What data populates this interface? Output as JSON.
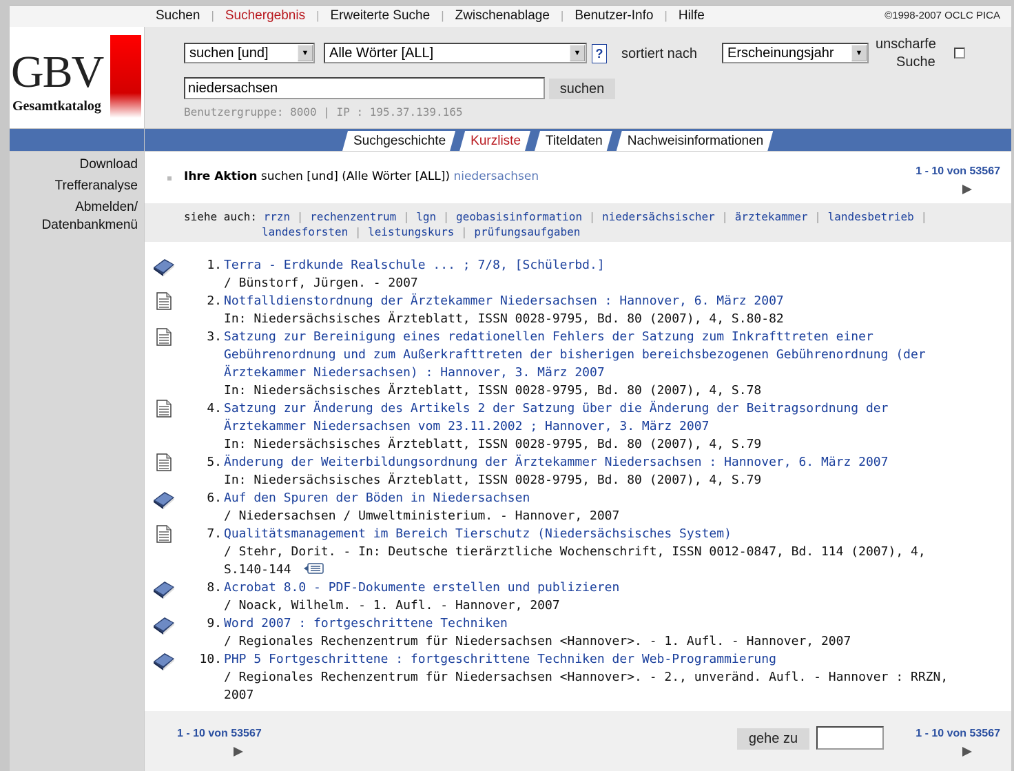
{
  "menu": {
    "items": [
      "Suchen",
      "Suchergebnis",
      "Erweiterte Suche",
      "Zwischenablage",
      "Benutzer-Info",
      "Hilfe"
    ],
    "active": "Suchergebnis",
    "copyright": "©1998-2007 OCLC PICA"
  },
  "logo": {
    "main": "GBV",
    "sub": "Gesamtkatalog"
  },
  "search": {
    "mode": "suchen [und]",
    "field": "Alle Wörter [ALL]",
    "help": "?",
    "sort_label": "sortiert nach",
    "sort_value": "Erscheinungsjahr",
    "fuzzy_label_1": "unscharfe",
    "fuzzy_label_2": "Suche",
    "query": "niedersachsen",
    "button": "suchen",
    "usergroup": "Benutzergruppe: 8000 | IP : 195.37.139.165"
  },
  "tabs": [
    {
      "label": "Suchgeschichte"
    },
    {
      "label": "Kurzliste",
      "active": true
    },
    {
      "label": "Titeldaten"
    },
    {
      "label": "Nachweisinformationen"
    }
  ],
  "sidebar": {
    "download": "Download",
    "analysis": "Trefferanalyse",
    "logout_1": "Abmelden/",
    "logout_2": "Datenbankmenü"
  },
  "action": {
    "prefix": "Ihre Aktion",
    "text": "suchen [und] (Alle Wörter [ALL])",
    "term": "niedersachsen"
  },
  "pager": {
    "range": "1 - 10 von 53567"
  },
  "seealso": {
    "label": "siehe auch:",
    "terms": [
      "rrzn",
      "rechenzentrum",
      "lgn",
      "geobasisinformation",
      "niedersächsischer",
      "ärztekammer",
      "landesbetrieb",
      "landesforsten",
      "leistungskurs",
      "prüfungsaufgaben"
    ]
  },
  "results": [
    {
      "num": "1.",
      "type": "book-icon",
      "title": "Terra - Erdkunde Realschule ... ; 7/8, [Schülerbd.]",
      "detail": "/ Bünstorf, Jürgen. - 2007"
    },
    {
      "num": "2.",
      "type": "article-icon",
      "title": "Notfalldienstordnung der Ärztekammer Niedersachsen : Hannover, 6. März 2007",
      "detail": "In: Niedersächsisches Ärzteblatt, ISSN 0028-9795, Bd. 80 (2007), 4, S.80-82"
    },
    {
      "num": "3.",
      "type": "article-icon",
      "title_lines": [
        "Satzung zur Bereinigung eines redationellen Fehlers der Satzung zum Inkrafttreten einer",
        "Gebührenordnung und zum Außerkrafttreten der bisherigen bereichsbezogenen Gebührenordnung (der",
        "Ärztekammer Niedersachsen) : Hannover, 3. März 2007"
      ],
      "detail": "In: Niedersächsisches Ärzteblatt, ISSN 0028-9795, Bd. 80 (2007), 4, S.78"
    },
    {
      "num": "4.",
      "type": "article-icon",
      "title_lines": [
        "Satzung zur Änderung des Artikels 2 der Satzung über die Änderung der Beitragsordnung der",
        "Ärztekammer Niedersachsen vom 23.11.2002 ; Hannover, 3. März 2007"
      ],
      "detail": "In: Niedersächsisches Ärzteblatt, ISSN 0028-9795, Bd. 80 (2007), 4, S.79"
    },
    {
      "num": "5.",
      "type": "article-icon",
      "title": "Änderung der Weiterbildungsordnung der Ärztekammer Niedersachsen : Hannover, 6. März 2007",
      "detail": "In: Niedersächsisches Ärzteblatt, ISSN 0028-9795, Bd. 80 (2007), 4, S.79"
    },
    {
      "num": "6.",
      "type": "book-icon",
      "title": "Auf den Spuren der Böden in Niedersachsen",
      "detail": "/ Niedersachsen / Umweltministerium. - Hannover, 2007"
    },
    {
      "num": "7.",
      "type": "article-icon",
      "title": "Qualitätsmanagement im Bereich Tierschutz (Niedersächsisches System)",
      "detail_lines": [
        "/ Stehr, Dorit. - In: Deutsche tierärztliche Wochenschrift, ISSN 0012-0847, Bd. 114 (2007), 4,",
        "S.140-144"
      ]
    },
    {
      "num": "8.",
      "type": "book-icon",
      "title": "Acrobat 8.0 - PDF-Dokumente erstellen und publizieren",
      "detail": "/ Noack, Wilhelm. - 1. Aufl. - Hannover, 2007"
    },
    {
      "num": "9.",
      "type": "book-icon",
      "title": "Word 2007 : fortgeschrittene Techniken",
      "detail": "/ Regionales Rechenzentrum für Niedersachsen <Hannover>. - 1. Aufl. - Hannover, 2007"
    },
    {
      "num": "10.",
      "type": "book-icon",
      "title": "PHP 5 Fortgeschrittene : fortgeschrittene Techniken der Web-Programmierung",
      "detail_lines": [
        "/ Regionales Rechenzentrum für Niedersachsen <Hannover>. - 2., unveränd. Aufl. - Hannover : RRZN,",
        "2007"
      ]
    }
  ],
  "footer": {
    "goto": "gehe zu"
  }
}
